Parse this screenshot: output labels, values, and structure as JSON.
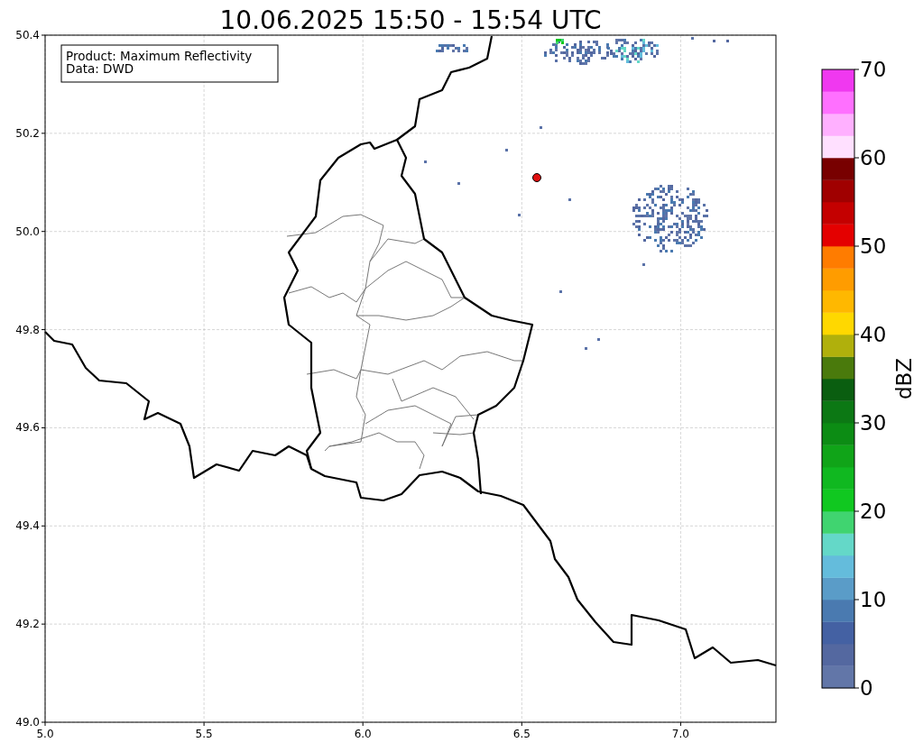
{
  "title": "10.06.2025 15:50 - 15:54 UTC",
  "legend": [
    "Product: Maximum Reflectivity",
    "Data: DWD"
  ],
  "map": {
    "xticks": [
      "5.0",
      "5.5",
      "6.0",
      "6.5",
      "7.0"
    ],
    "yticks": [
      "50.4",
      "50.2",
      "50.0",
      "49.8",
      "49.6",
      "49.4",
      "49.2",
      "49.0"
    ]
  },
  "colorbar": {
    "label": "dBZ",
    "ticks": [
      "70",
      "60",
      "50",
      "40",
      "30",
      "20",
      "10",
      "0"
    ],
    "segments": [
      {
        "color": "#6276a8"
      },
      {
        "color": "#5468a0"
      },
      {
        "color": "#4461a3"
      },
      {
        "color": "#4a7ab0"
      },
      {
        "color": "#5a9cc8"
      },
      {
        "color": "#64bcdc"
      },
      {
        "color": "#64d8c8"
      },
      {
        "color": "#40d470"
      },
      {
        "color": "#10c820"
      },
      {
        "color": "#10b820"
      },
      {
        "color": "#10a418"
      },
      {
        "color": "#0c8c14"
      },
      {
        "color": "#0c7814"
      },
      {
        "color": "#0a5e10"
      },
      {
        "color": "#4a7a0c"
      },
      {
        "color": "#b0b00c"
      },
      {
        "color": "#ffd800"
      },
      {
        "color": "#ffb800"
      },
      {
        "color": "#ff9c00"
      },
      {
        "color": "#ff7c00"
      },
      {
        "color": "#e40000"
      },
      {
        "color": "#c40000"
      },
      {
        "color": "#a00000"
      },
      {
        "color": "#780000"
      },
      {
        "color": "#ffe0ff"
      },
      {
        "color": "#ffb0ff"
      },
      {
        "color": "#ff70ff"
      },
      {
        "color": "#f038f0"
      }
    ]
  }
}
